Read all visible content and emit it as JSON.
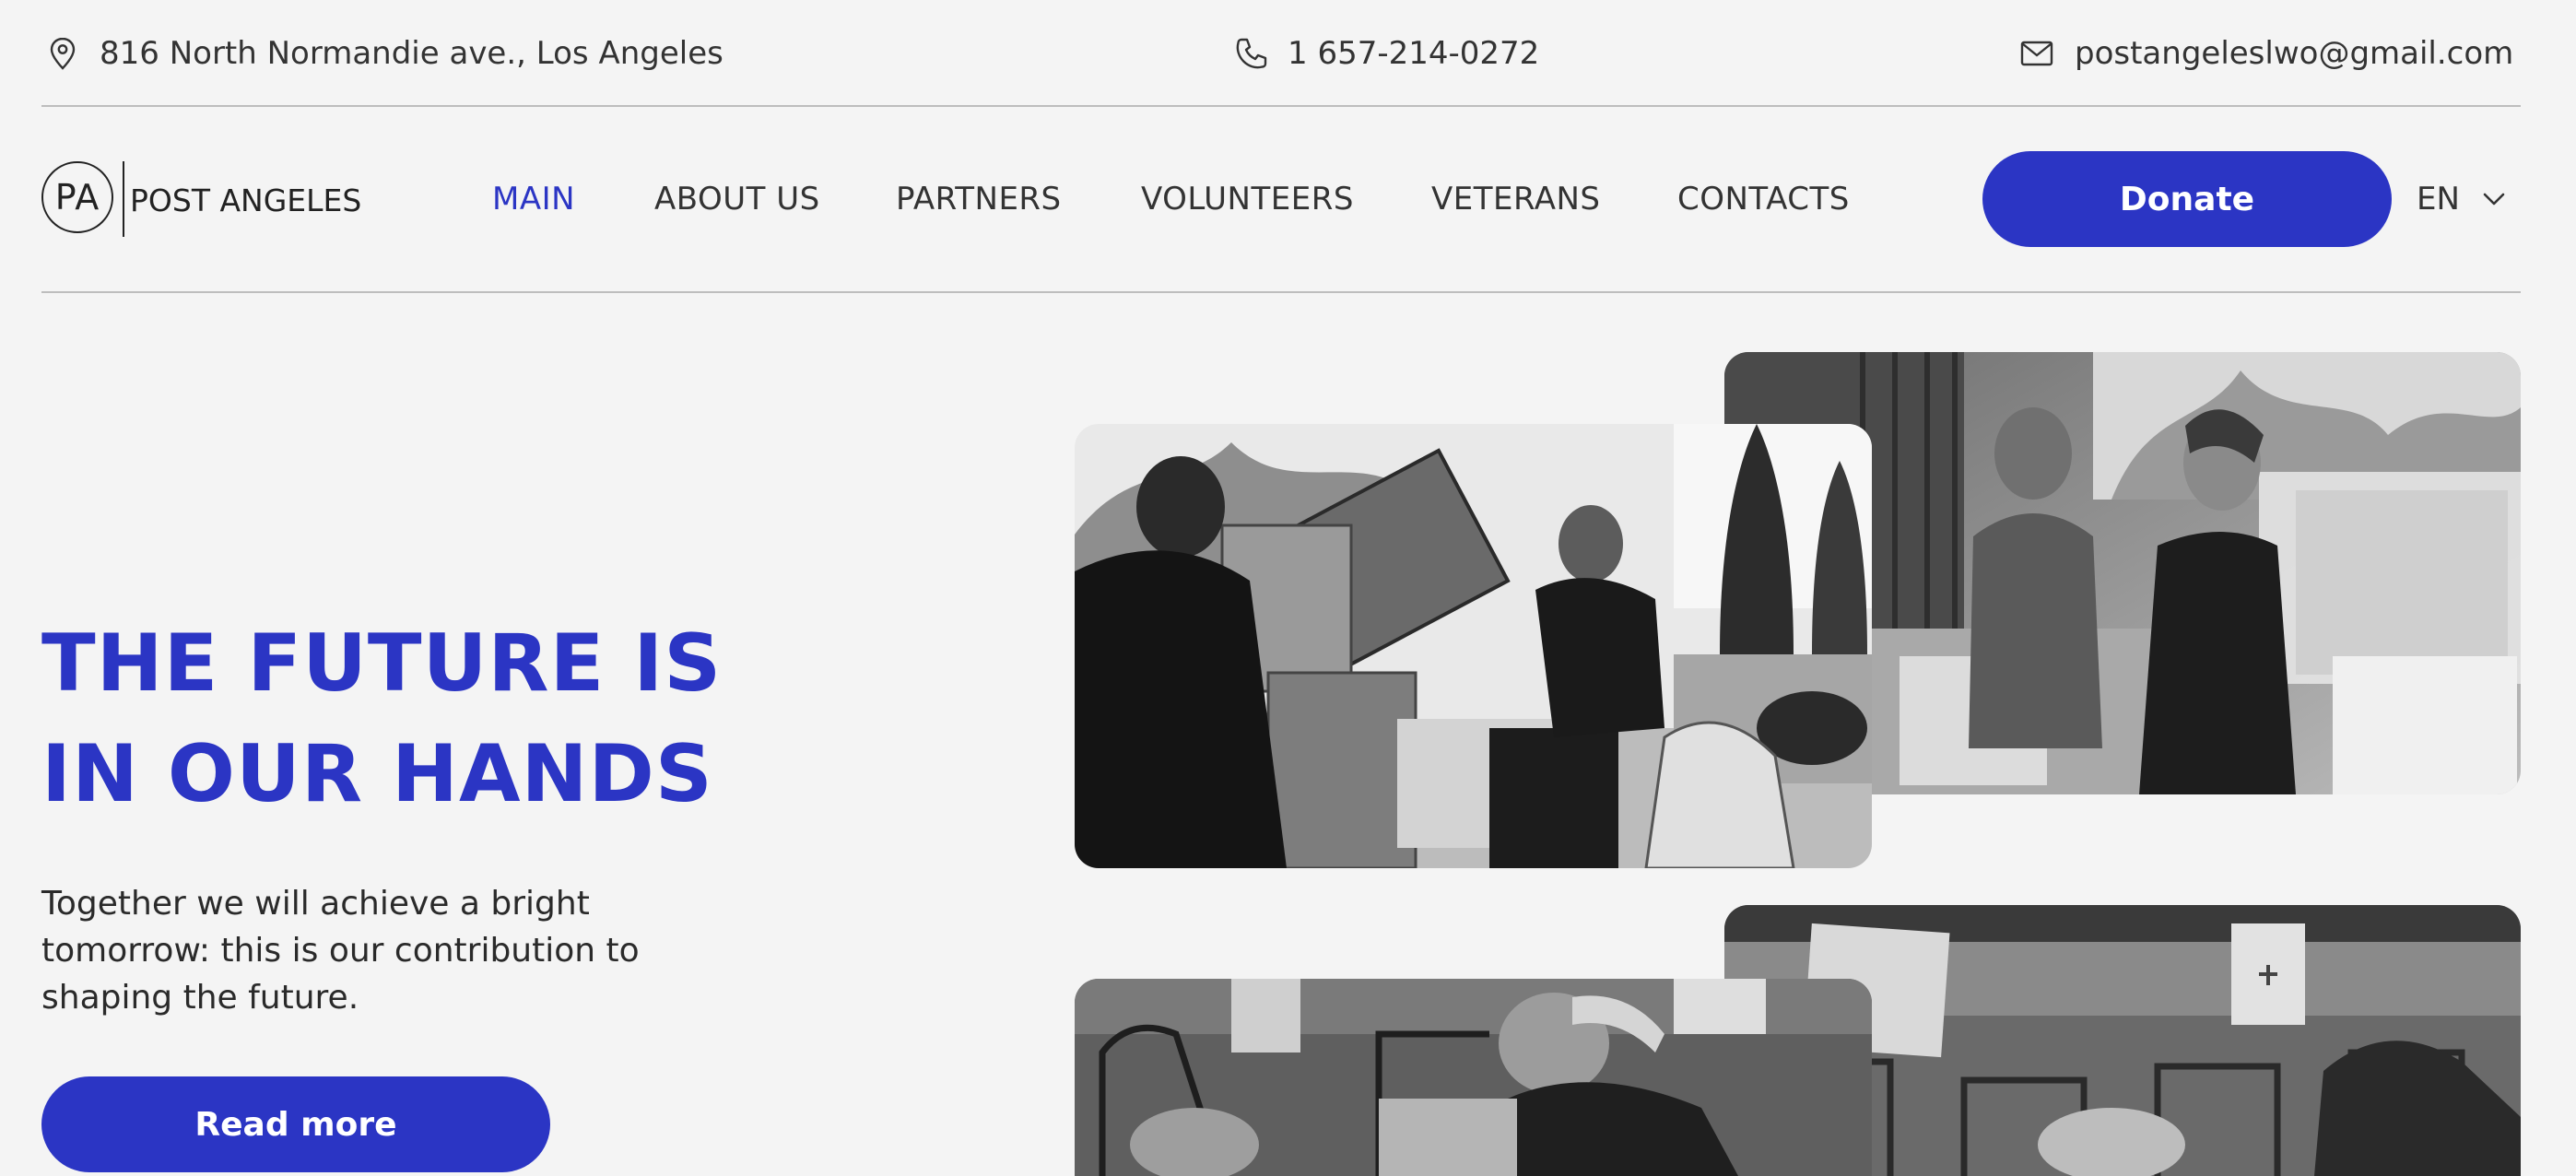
{
  "topbar": {
    "address": "816 North Normandie ave., Los Angeles",
    "phone": "1 657-214-0272",
    "email": "postangeleslwo@gmail.com",
    "icons": [
      "map-pin-icon",
      "phone-icon",
      "mail-icon"
    ]
  },
  "logo": {
    "monogram": "PA",
    "name": "POST ANGELES"
  },
  "nav": {
    "items": [
      {
        "label": "MAIN",
        "active": true
      },
      {
        "label": "ABOUT US",
        "active": false
      },
      {
        "label": "PARTNERS",
        "active": false
      },
      {
        "label": "VOLUNTEERS",
        "active": false
      },
      {
        "label": "VETERANS",
        "active": false
      },
      {
        "label": "CONTACTS",
        "active": false
      }
    ],
    "donate_label": "Donate",
    "language": "EN"
  },
  "hero": {
    "title_line1": "THE FUTURE IS",
    "title_line2": "IN OUR HANDS",
    "subtitle": "Together we will achieve a bright tomorrow: this is our contribution to shaping the future.",
    "read_more_label": "Read more"
  },
  "colors": {
    "accent": "#2b35c4",
    "background": "#f4f4f4",
    "text": "#222222"
  }
}
